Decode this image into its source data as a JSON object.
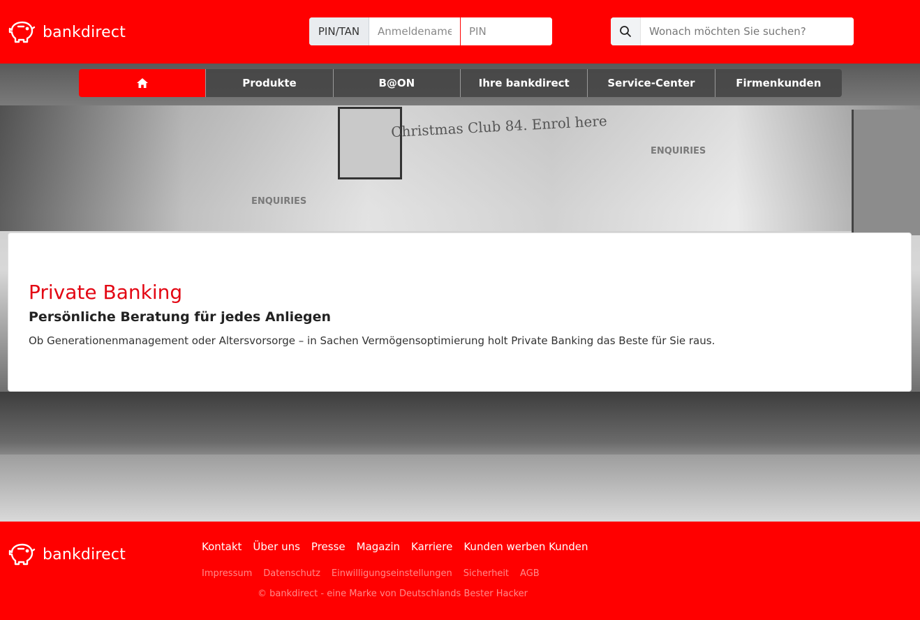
{
  "brand": {
    "name": "bankdirect"
  },
  "login": {
    "mode_label": "PIN/TAN",
    "username_placeholder": "Anmeldename",
    "pin_placeholder": "PIN"
  },
  "search": {
    "placeholder": "Wonach möchten Sie suchen?"
  },
  "nav": {
    "items": [
      "Produkte",
      "B@ON",
      "Ihre bankdirect",
      "Service-Center",
      "Firmenkunden"
    ]
  },
  "hero": {
    "sign_text": "Christmas Club 84. Enrol here",
    "enquiries_label": "ENQUIRIES"
  },
  "card": {
    "title": "Private Banking",
    "subtitle": "Persönliche Beratung für jedes Anliegen",
    "text": "Ob Generationenmanagement oder Altersvorsorge – in Sachen Vermögensoptimierung holt Private Banking das Beste für Sie raus."
  },
  "footer": {
    "primary_links": [
      "Kontakt",
      "Über uns",
      "Presse",
      "Magazin",
      "Karriere",
      "Kunden werben Kunden"
    ],
    "secondary_links": [
      "Impressum",
      "Datenschutz",
      "Einwilligungseinstellungen",
      "Sicherheit",
      "AGB"
    ],
    "copyright": "© bankdirect - eine Marke von Deutschlands Bester Hacker"
  },
  "colors": {
    "brand_red": "#ff0000",
    "title_red": "#e30613",
    "nav_gray": "#464646"
  }
}
